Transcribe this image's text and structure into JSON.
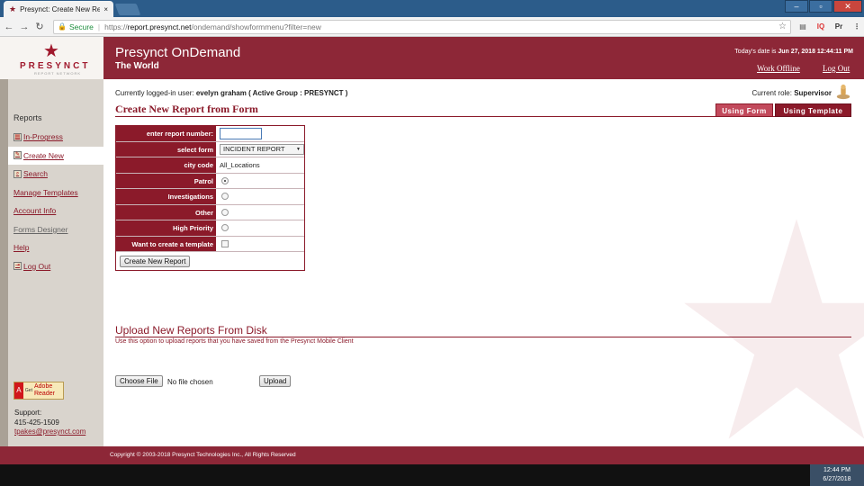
{
  "browser": {
    "tab_title": "Presynct: Create New Rep",
    "tab_close": "×",
    "secure_label": "Secure",
    "url_scheme": "https://",
    "url_host": "report.presynct.net",
    "url_path": "/ondemand/showformmenu?filter=new",
    "extensions": [
      "IQ",
      "Pr"
    ]
  },
  "header": {
    "logo_text": "PRESYNCT",
    "logo_subtext": "REPORT NETWORK",
    "app_title": "Presynct OnDemand",
    "app_subtitle": "The World",
    "date_prefix": "Today's date is ",
    "date_value": "Jun 27, 2018 12:44:11 PM",
    "work_offline": "Work Offline",
    "logout": "Log Out"
  },
  "sidebar": {
    "heading": "Reports",
    "items": [
      {
        "label": "In-Progress",
        "icon": "report-icon"
      },
      {
        "label": "Create New",
        "icon": "edit-icon"
      },
      {
        "label": "Search",
        "icon": "search-icon"
      },
      {
        "label": "Manage Templates",
        "icon": ""
      },
      {
        "label": "Account Info",
        "icon": ""
      },
      {
        "label": "Forms Designer",
        "icon": ""
      },
      {
        "label": "Help",
        "icon": ""
      },
      {
        "label": "Log Out",
        "icon": "logout-icon"
      }
    ],
    "adobe_get": "Get",
    "adobe_label": "Adobe Reader",
    "support_label": "Support:",
    "support_phone": "415-425-1509",
    "support_email": "tpakes@presynct.com"
  },
  "main": {
    "login_prefix": "Currently logged-in user: ",
    "login_user": "evelyn graham ( Active Group : PRESYNCT )",
    "role_prefix": "Current role: ",
    "role_value": "Supervisor",
    "form_title": "Create New Report from Form",
    "tab_form": "Using Form",
    "tab_template": "Using Template",
    "fields": {
      "report_number_label": "enter report number:",
      "report_number_value": "",
      "select_form_label": "select form",
      "select_form_value": "INCIDENT REPORT",
      "city_code_label": "city code",
      "city_code_value": "All_Locations",
      "patrol_label": "Patrol",
      "investigations_label": "Investigations",
      "other_label": "Other",
      "high_priority_label": "High Priority",
      "template_label": "Want to create a template",
      "selected_radio": "Patrol"
    },
    "create_button": "Create New Report",
    "upload_title": "Upload New Reports From Disk",
    "upload_desc": "Use this option to upload reports that you have saved from the Presynct Mobile Client",
    "choose_file": "Choose File",
    "no_file": "No file chosen",
    "upload_button": "Upload"
  },
  "footer": {
    "copyright": "Copyright © 2003-2018 Presynct Technologies Inc., All Rights Reserved"
  },
  "taskbar": {
    "time": "12:44 PM",
    "date": "6/27/2018"
  },
  "colors": {
    "brand": "#8d2737",
    "accent_tab": "#c24a5c",
    "sidebar_bg": "#d9d4cd"
  }
}
